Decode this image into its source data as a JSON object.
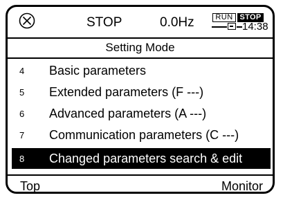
{
  "status": {
    "icon": "circle-x-icon",
    "state": "STOP",
    "frequency": "0.0Hz",
    "run_label": "RUN",
    "stop_label": "STOP",
    "clock": "14:38"
  },
  "title": "Setting Mode",
  "menu": {
    "items": [
      {
        "num": "4",
        "label": "Basic parameters"
      },
      {
        "num": "5",
        "label": "Extended parameters (F ---)"
      },
      {
        "num": "6",
        "label": "Advanced parameters (A ---)"
      },
      {
        "num": "7",
        "label": "Communication parameters (C ---)"
      },
      {
        "num": "8",
        "label": "Changed parameters search & edit"
      }
    ],
    "selected_index": 4
  },
  "softkeys": {
    "left": "Top",
    "right": "Monitor"
  },
  "colors": {
    "foreground": "#000000",
    "background": "#ffffff"
  }
}
